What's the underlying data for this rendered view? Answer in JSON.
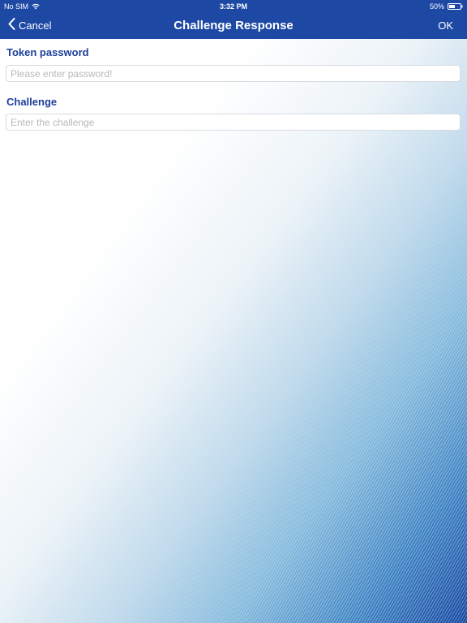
{
  "status_bar": {
    "carrier": "No SIM",
    "time": "3:32 PM",
    "battery": "50%"
  },
  "nav": {
    "cancel_label": "Cancel",
    "title": "Challenge Response",
    "ok_label": "OK"
  },
  "form": {
    "token_password": {
      "label": "Token password",
      "value": "",
      "placeholder": "Please enter password!"
    },
    "challenge": {
      "label": "Challenge",
      "value": "",
      "placeholder": "Enter the challenge"
    }
  },
  "colors": {
    "header_bg": "#1d49a5",
    "label_text": "#1d3f9c",
    "placeholder_text": "#b8b8b8",
    "input_border": "#d6dbe2"
  },
  "icons": {
    "wifi": "wifi-icon",
    "battery": "battery-icon",
    "back": "chevron-left-icon"
  }
}
